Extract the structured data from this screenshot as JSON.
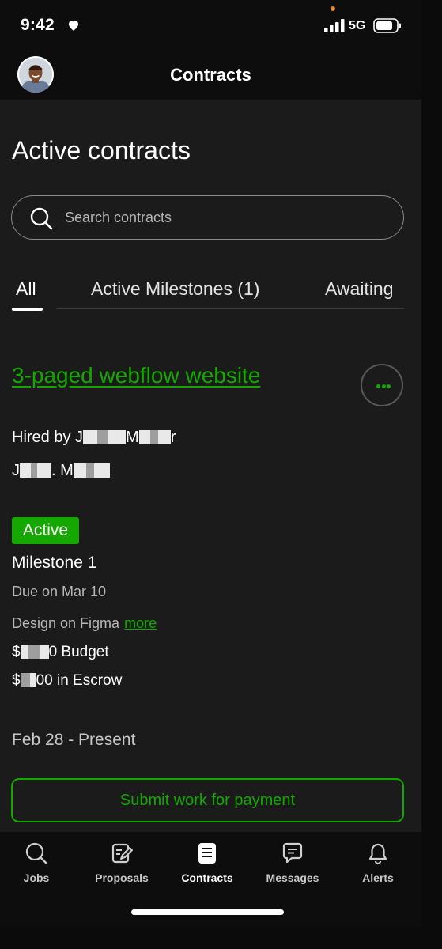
{
  "status_bar": {
    "time": "9:42",
    "network": "5G"
  },
  "header": {
    "title": "Contracts"
  },
  "page": {
    "title": "Active contracts"
  },
  "search": {
    "placeholder": "Search contracts"
  },
  "tabs": [
    {
      "label": "All",
      "active": true
    },
    {
      "label": "Active Milestones (1)",
      "active": false
    },
    {
      "label": "Awaiting",
      "active": false
    }
  ],
  "contract": {
    "title": "3-paged webflow website",
    "hired_prefix": "Hired by J",
    "hired_mid": "M",
    "hired_end": "r",
    "line2_start": "J",
    "line2_mid": ". M",
    "status": "Active",
    "milestone": "Milestone 1",
    "due": "Due on Mar 10",
    "description": "Design on Figma",
    "more_link": "more",
    "budget_prefix": "$",
    "budget_suffix": "0 Budget",
    "escrow_prefix": "$",
    "escrow_suffix": "00 in Escrow",
    "period": "Feb 28 - Present",
    "submit_label": "Submit work for payment"
  },
  "bottom_nav": [
    {
      "label": "Jobs",
      "icon": "search-icon"
    },
    {
      "label": "Proposals",
      "icon": "proposals-icon"
    },
    {
      "label": "Contracts",
      "icon": "contracts-icon",
      "active": true
    },
    {
      "label": "Messages",
      "icon": "messages-icon"
    },
    {
      "label": "Alerts",
      "icon": "bell-icon"
    }
  ],
  "colors": {
    "accent": "#14a800",
    "background": "#1b1b1b",
    "bar": "#0d0d0d"
  }
}
